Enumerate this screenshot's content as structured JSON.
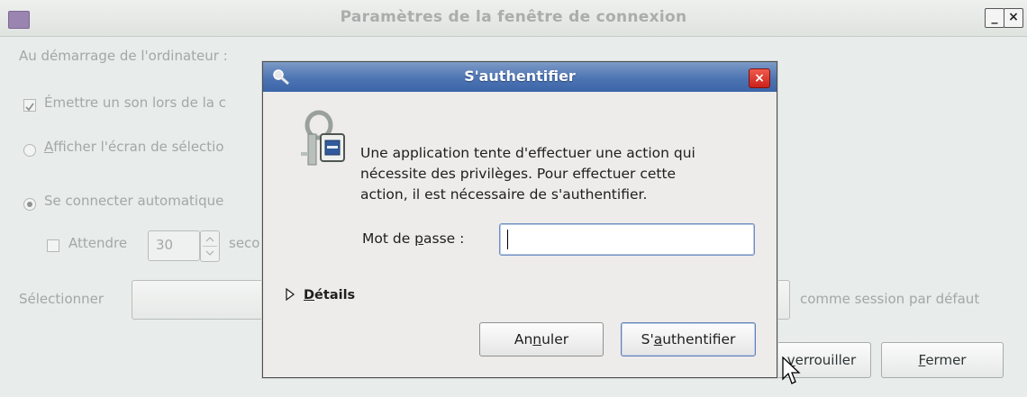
{
  "back_window": {
    "title": "Paramètres de la fenêtre de connexion",
    "minimize_glyph": "_",
    "close_glyph": "×",
    "section_label": "Au démarrage de l'ordinateur :",
    "sound_option": "Émettre un son lors de la c",
    "show_screen_option": "fficher l'écran de sélectio",
    "show_screen_mnemonic": "A",
    "auto_login_option": "Se connecter automatique",
    "wait_label": "Attendre",
    "wait_value": "30",
    "seconds_label": "seco",
    "select_label": "Sélectionner",
    "default_session_label": "comme session par défaut",
    "unlock_button": "errouiller",
    "unlock_mnemonic": "v",
    "close_button_mnemonic": "F",
    "close_button_rest": "ermer"
  },
  "dialog": {
    "title": "S'authentifier",
    "close_glyph": "×",
    "message_line1": "Une application tente d'effectuer une action qui",
    "message_line2": "nécessite des privilèges. Pour effectuer cette",
    "message_line3": "action, il est nécessaire de s'authentifier.",
    "password_label_prefix": "Mot de ",
    "password_label_mnemonic": "p",
    "password_label_suffix": "asse :",
    "password_value": "",
    "details_mnemonic": "D",
    "details_rest": "étails",
    "cancel_prefix": "An",
    "cancel_mnemonic": "n",
    "cancel_suffix": "uler",
    "auth_prefix": "S'",
    "auth_mnemonic": "a",
    "auth_suffix": "uthentifier"
  },
  "icons": [
    "app-icon",
    "keys-icon",
    "lock-keys-icon",
    "expander-arrow-icon",
    "mouse-cursor-icon"
  ],
  "colors": {
    "titlebar_active": "#4d74b3",
    "close_red": "#d8312a",
    "focus_border": "#6f8fc0"
  }
}
